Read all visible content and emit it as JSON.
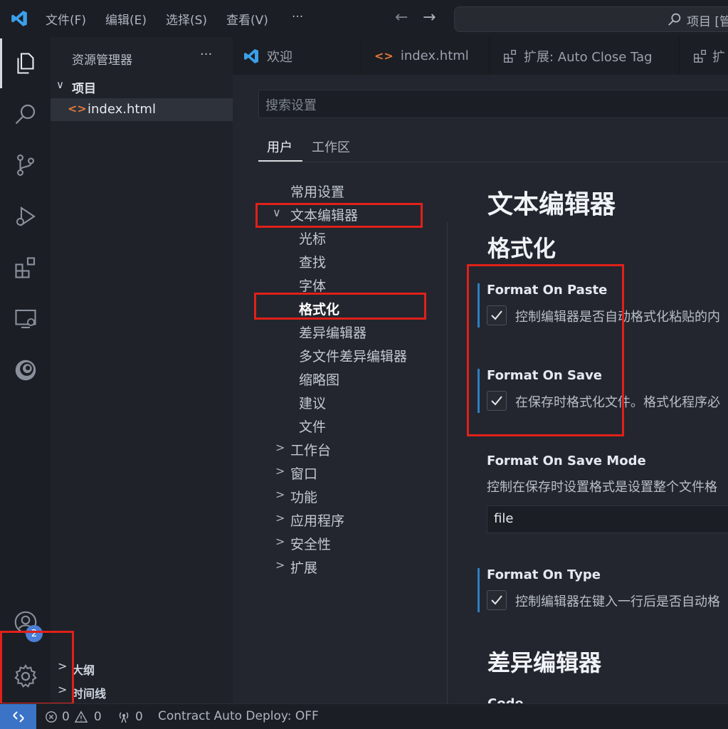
{
  "titlebar": {
    "menus": [
      "文件(F)",
      "编辑(E)",
      "选择(S)",
      "查看(V)",
      "···"
    ],
    "search_text": "项目 [管"
  },
  "sidebar": {
    "title": "资源管理器",
    "more": "···",
    "folder": "项目",
    "file": "index.html",
    "outline": "大纲",
    "timeline": "时间线"
  },
  "accounts_badge": "2",
  "tabs": [
    {
      "label": "欢迎",
      "icon": "vscode-logo-icon"
    },
    {
      "label": "index.html",
      "icon": "html-file-icon"
    },
    {
      "label": "扩展: Auto Close Tag",
      "icon": "extension-preview-icon"
    },
    {
      "label": "扩",
      "icon": "extension-preview-icon"
    }
  ],
  "settings": {
    "search_placeholder": "搜索设置",
    "scope_tabs": [
      "用户",
      "工作区"
    ],
    "toc": {
      "common": "常用设置",
      "text_editor": "文本编辑器",
      "children": [
        "光标",
        "查找",
        "字体",
        "格式化",
        "差异编辑器",
        "多文件差异编辑器",
        "缩略图",
        "建议",
        "文件"
      ],
      "others": [
        "工作台",
        "窗口",
        "功能",
        "应用程序",
        "安全性",
        "扩展"
      ]
    },
    "section_title": "文本编辑器",
    "subsection_title": "格式化",
    "items": {
      "paste": {
        "title": "Format On Paste",
        "desc": "控制编辑器是否自动格式化粘贴的内",
        "checked": true
      },
      "save": {
        "title": "Format On Save",
        "desc": "在保存时格式化文件。格式化程序必",
        "checked": true
      },
      "mode": {
        "title": "Format On Save Mode",
        "desc": "控制在保存时设置格式是设置整个文件格",
        "value": "file"
      },
      "type": {
        "title": "Format On Type",
        "desc": "控制编辑器在键入一行后是否自动格",
        "checked": true
      }
    },
    "next_section": "差异编辑器",
    "next_partial": "Code"
  },
  "statusbar": {
    "errors": "0",
    "warnings": "0",
    "ports": "0",
    "contract": "Contract Auto Deploy: OFF"
  },
  "colors": {
    "accent": "#2e7fc1",
    "annotation": "#e0201a",
    "remote": "#3b74c7"
  }
}
